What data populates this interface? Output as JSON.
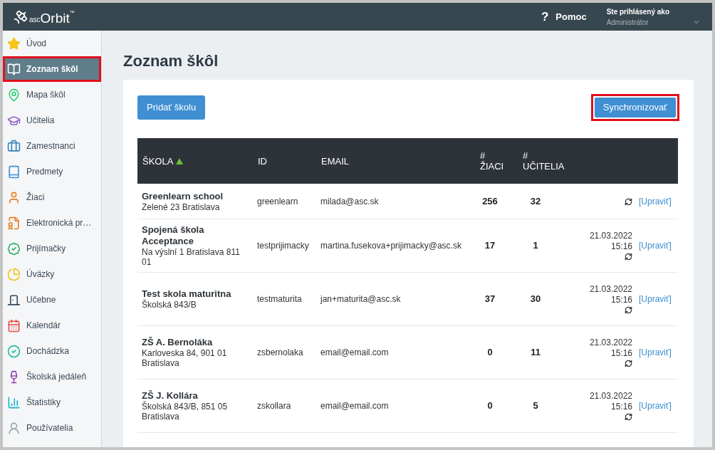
{
  "header": {
    "logo": {
      "prefix": "asc",
      "name": "Orbit",
      "mark": "™"
    },
    "help": {
      "icon": "?",
      "label": "Pomoc"
    },
    "user": {
      "caption": "Ste prihlásený ako",
      "name": "Administrátor"
    }
  },
  "sidebar": {
    "items": [
      {
        "label": "Úvod",
        "selected": false,
        "highlighted": false
      },
      {
        "label": "Zoznam škôl",
        "selected": true,
        "highlighted": true
      },
      {
        "label": "Mapa škôl",
        "selected": false,
        "highlighted": false
      },
      {
        "label": "Učitelia",
        "selected": false,
        "highlighted": false
      },
      {
        "label": "Zamestnanci",
        "selected": false,
        "highlighted": false
      },
      {
        "label": "Predmety",
        "selected": false,
        "highlighted": false
      },
      {
        "label": "Žiaci",
        "selected": false,
        "highlighted": false
      },
      {
        "label": "Elektronická pr…",
        "selected": false,
        "highlighted": false
      },
      {
        "label": "Prijímačky",
        "selected": false,
        "highlighted": false
      },
      {
        "label": "Úväzky",
        "selected": false,
        "highlighted": false
      },
      {
        "label": "Učebne",
        "selected": false,
        "highlighted": false
      },
      {
        "label": "Kalendár",
        "selected": false,
        "highlighted": false
      },
      {
        "label": "Dochádzka",
        "selected": false,
        "highlighted": false
      },
      {
        "label": "Školská jedáleň",
        "selected": false,
        "highlighted": false
      },
      {
        "label": "Štatistiky",
        "selected": false,
        "highlighted": false
      },
      {
        "label": "Používatelia",
        "selected": false,
        "highlighted": false
      }
    ]
  },
  "page": {
    "title": "Zoznam škôl"
  },
  "toolbar": {
    "add_button": {
      "label": "Pridať školu",
      "highlighted": false
    },
    "sync_button": {
      "label": "Synchronizovať",
      "highlighted": true
    }
  },
  "table": {
    "columns": [
      {
        "lines": [
          "ŠKOLA"
        ],
        "sorted": true
      },
      {
        "lines": [
          "ID"
        ],
        "sorted": false
      },
      {
        "lines": [
          "EMAIL"
        ],
        "sorted": false
      },
      {
        "lines": [
          "#",
          "ŽIACI"
        ],
        "sorted": false
      },
      {
        "lines": [
          "#",
          "UČITELIA"
        ],
        "sorted": false
      }
    ],
    "rows": [
      {
        "name": "Greenlearn school",
        "address": "Zelené 23 Bratislava",
        "id": "greenlearn",
        "email": "milada@asc.sk",
        "students": "256",
        "teachers": "32",
        "edit": "[Upraviť]"
      },
      {
        "name": "Spojená škola Acceptance",
        "address": "Na výslní 1 Bratislava 811 01",
        "id": "testprijimacky",
        "email": "martina.fusekova+prijimacky@asc.sk",
        "students": "17",
        "teachers": "1",
        "date": "21.03.2022",
        "time": "15:16",
        "edit": "[Upraviť]"
      },
      {
        "name": "Test skola maturitna",
        "address": "Školská 843/B",
        "id": "testmaturita",
        "email": "jan+maturita@asc.sk",
        "students": "37",
        "teachers": "30",
        "date": "21.03.2022",
        "time": "15:16",
        "edit": "[Upraviť]"
      },
      {
        "name": "ZŠ A. Bernoláka",
        "address": "Karloveska 84, 901 01 Bratislava",
        "id": "zsbernolaka",
        "email": "email@email.com",
        "students": "0",
        "teachers": "11",
        "date": "21.03.2022",
        "time": "15:16",
        "edit": "[Upraviť]"
      },
      {
        "name": "ZŠ J. Kollára",
        "address": "Školská 843/B, 851 05 Bratislava",
        "id": "zskollara",
        "email": "email@email.com",
        "students": "0",
        "teachers": "5",
        "date": "21.03.2022",
        "time": "15:16",
        "edit": "[Upraviť]"
      }
    ]
  }
}
